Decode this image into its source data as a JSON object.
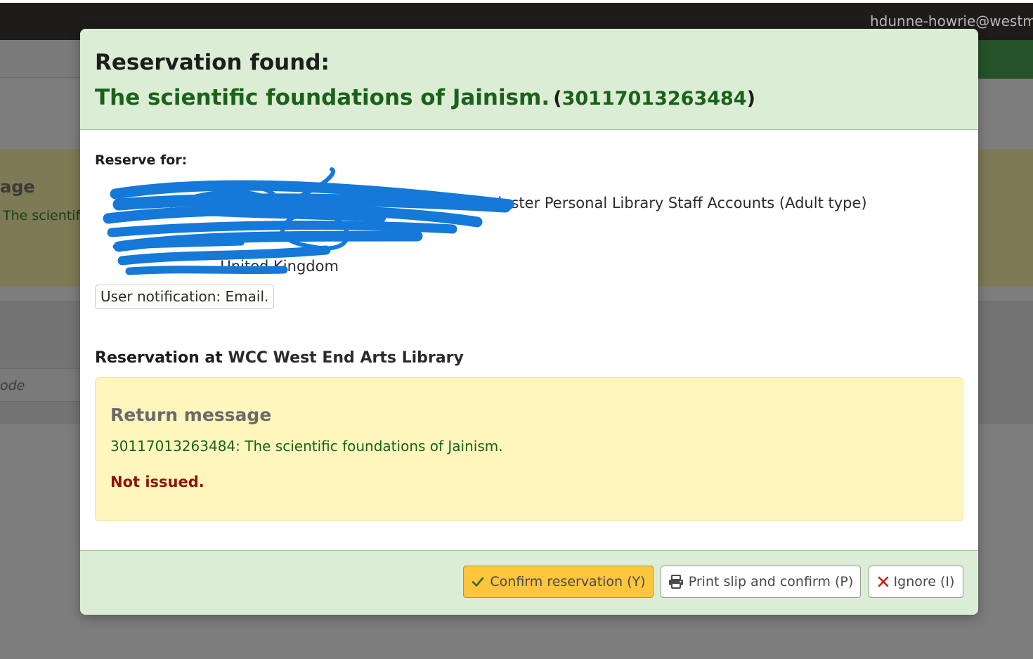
{
  "background": {
    "user_email": "hdunne-howrie@westm",
    "message_title_partial": "age",
    "message_text_partial": "The scientifi",
    "input_placeholder_partial": "ode"
  },
  "modal": {
    "title": "Reservation found:",
    "book_title": "The scientific foundations of Jainism.",
    "barcode_open": "(",
    "barcode": "30117013263484",
    "barcode_close": ")",
    "reserve_for_label": "Reserve for:",
    "patron_category": "- Westminster Personal Library Staff Accounts (Adult type)",
    "address_line_partial": ", United Kingdom",
    "notification": "User notification: Email.",
    "reservation_at_label": "Reservation at",
    "reservation_branch": "WCC West End Arts Library",
    "return_message": {
      "title": "Return message",
      "text": "30117013263484: The scientific foundations of Jainism.",
      "status": "Not issued."
    }
  },
  "buttons": {
    "confirm": "Confirm reservation (Y)",
    "print": "Print slip and confirm (P)",
    "ignore": "Ignore (I)"
  },
  "icons": {
    "confirm": "check-icon",
    "print": "printer-icon",
    "ignore": "x-icon"
  },
  "colors": {
    "header_bg": "#dcedd6",
    "title_green": "#1a6219",
    "warning_bg": "#fff6bd",
    "error_red": "#8f1208",
    "confirm_btn": "#ffc53d",
    "redaction": "#1479d8"
  }
}
